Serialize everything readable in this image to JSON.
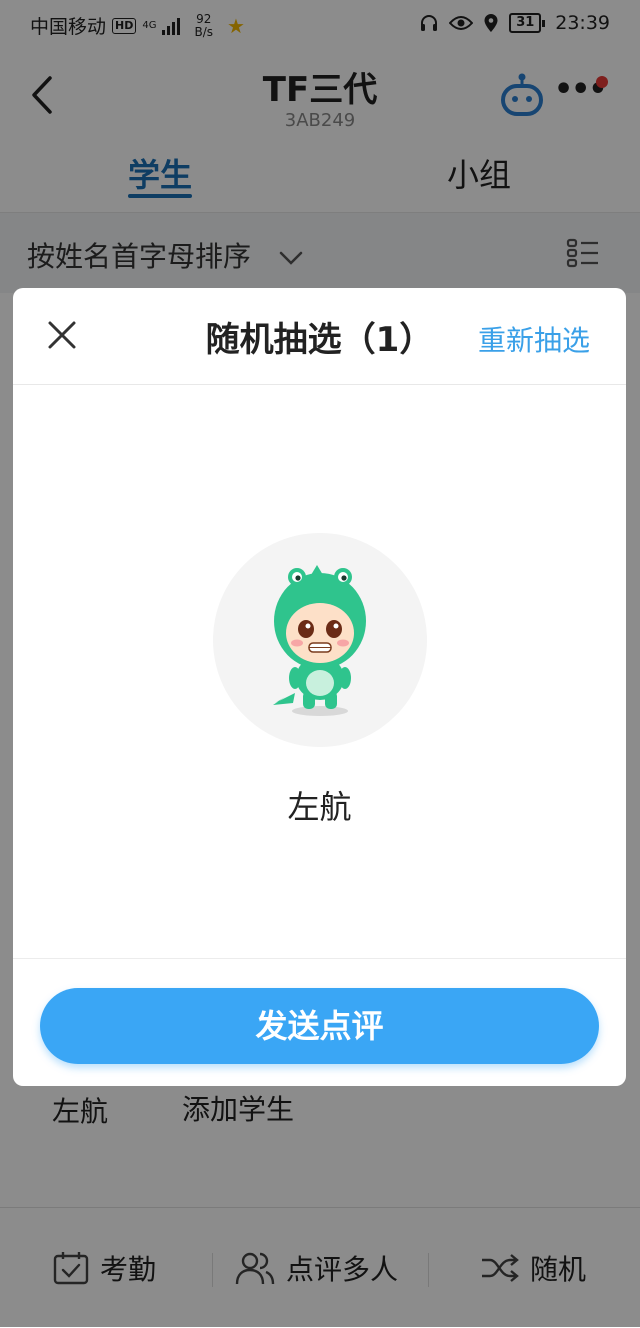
{
  "status_bar": {
    "carrier": "中国移动",
    "hd": "HD",
    "network": "4G",
    "speed_value": "92",
    "speed_unit": "B/s",
    "battery": "31",
    "time": "23:39"
  },
  "nav": {
    "title": "TF三代",
    "subtitle": "3AB249"
  },
  "tabs": [
    {
      "label": "学生",
      "active": true
    },
    {
      "label": "小组",
      "active": false
    }
  ],
  "sort": {
    "label": "按姓名首字母排序"
  },
  "background_list": {
    "student_name": "左航",
    "add_student": "添加学生"
  },
  "bottom_bar": {
    "attendance": "考勤",
    "multi_review": "点评多人",
    "random": "随机"
  },
  "modal": {
    "title": "随机抽选（1）",
    "redraw": "重新抽选",
    "student_name": "左航",
    "send_button": "发送点评"
  },
  "colors": {
    "accent": "#3aa6f5",
    "tab_active": "#1a6fb5",
    "notification_dot": "#e53935",
    "avatar_green": "#2fc48d"
  }
}
